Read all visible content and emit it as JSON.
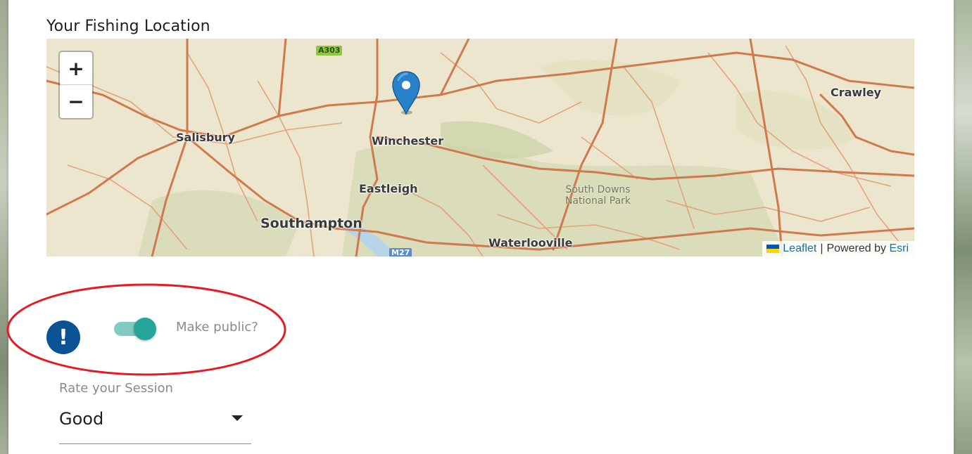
{
  "section": {
    "title": "Your Fishing Location"
  },
  "map": {
    "zoom_in": "+",
    "zoom_out": "−",
    "places": {
      "salisbury": "Salisbury",
      "winchester": "Winchester",
      "eastleigh": "Eastleigh",
      "southampton": "Southampton",
      "waterlooville": "Waterlooville",
      "crawley": "Crawley",
      "park_line1": "South Downs",
      "park_line2": "National Park"
    },
    "road_badges": {
      "a303": "A303",
      "m27": "M27"
    },
    "attribution": {
      "leaflet": "Leaflet",
      "separator": "|",
      "powered_by": "Powered by",
      "esri": "Esri"
    },
    "colors": {
      "base": "#ede6cf",
      "roads": "#cf7a4e",
      "minor_roads": "#e3a37b",
      "woodland": "#c7cfa6",
      "marker": "#2a81cb"
    }
  },
  "visibility": {
    "icon": "exclamation-icon",
    "label": "Make public?",
    "toggle_on": true,
    "accent": "#26a69a"
  },
  "rating": {
    "label": "Rate your Session",
    "selected": "Good"
  },
  "annotation": {
    "color": "#e31b23"
  }
}
